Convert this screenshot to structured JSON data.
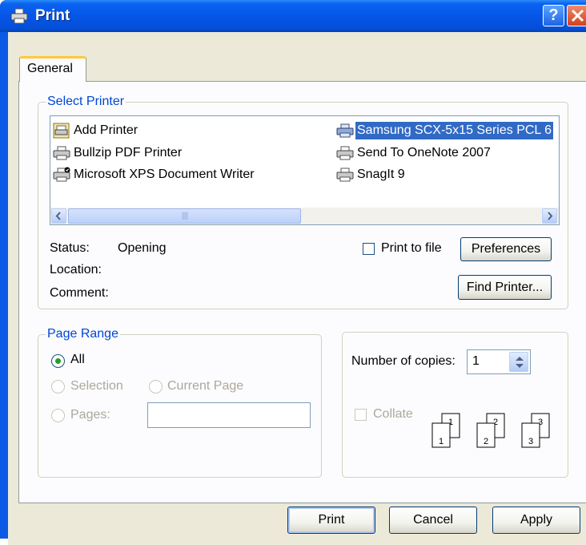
{
  "window": {
    "title": "Print"
  },
  "tabs": [
    {
      "label": "General"
    }
  ],
  "select_printer": {
    "legend": "Select Printer",
    "printers": [
      {
        "label": "Add Printer",
        "icon": "add-printer-icon",
        "selected": false
      },
      {
        "label": "Bullzip PDF Printer",
        "icon": "printer-icon",
        "selected": false
      },
      {
        "label": "Microsoft XPS Document Writer",
        "icon": "printer-icon",
        "selected": false
      },
      {
        "label": "Samsung SCX-5x15 Series PCL 6",
        "icon": "printer-icon",
        "selected": true
      },
      {
        "label": "Send To OneNote 2007",
        "icon": "printer-icon",
        "selected": false
      },
      {
        "label": "SnagIt 9",
        "icon": "printer-icon",
        "selected": false
      }
    ],
    "status_label": "Status:",
    "status_value": "Opening",
    "location_label": "Location:",
    "comment_label": "Comment:",
    "print_to_file_label": "Print to file",
    "preferences_label": "Preferences",
    "find_printer_label": "Find Printer..."
  },
  "page_range": {
    "legend": "Page Range",
    "all_label": "All",
    "selection_label": "Selection",
    "current_page_label": "Current Page",
    "pages_label": "Pages:"
  },
  "copies": {
    "number_label": "Number of copies:",
    "value": "1",
    "collate_label": "Collate"
  },
  "buttons": {
    "print": "Print",
    "cancel": "Cancel",
    "apply": "Apply"
  },
  "colors": {
    "selection": "#316ac5",
    "legend": "#0046d5",
    "titlebar": "#0556e8"
  }
}
